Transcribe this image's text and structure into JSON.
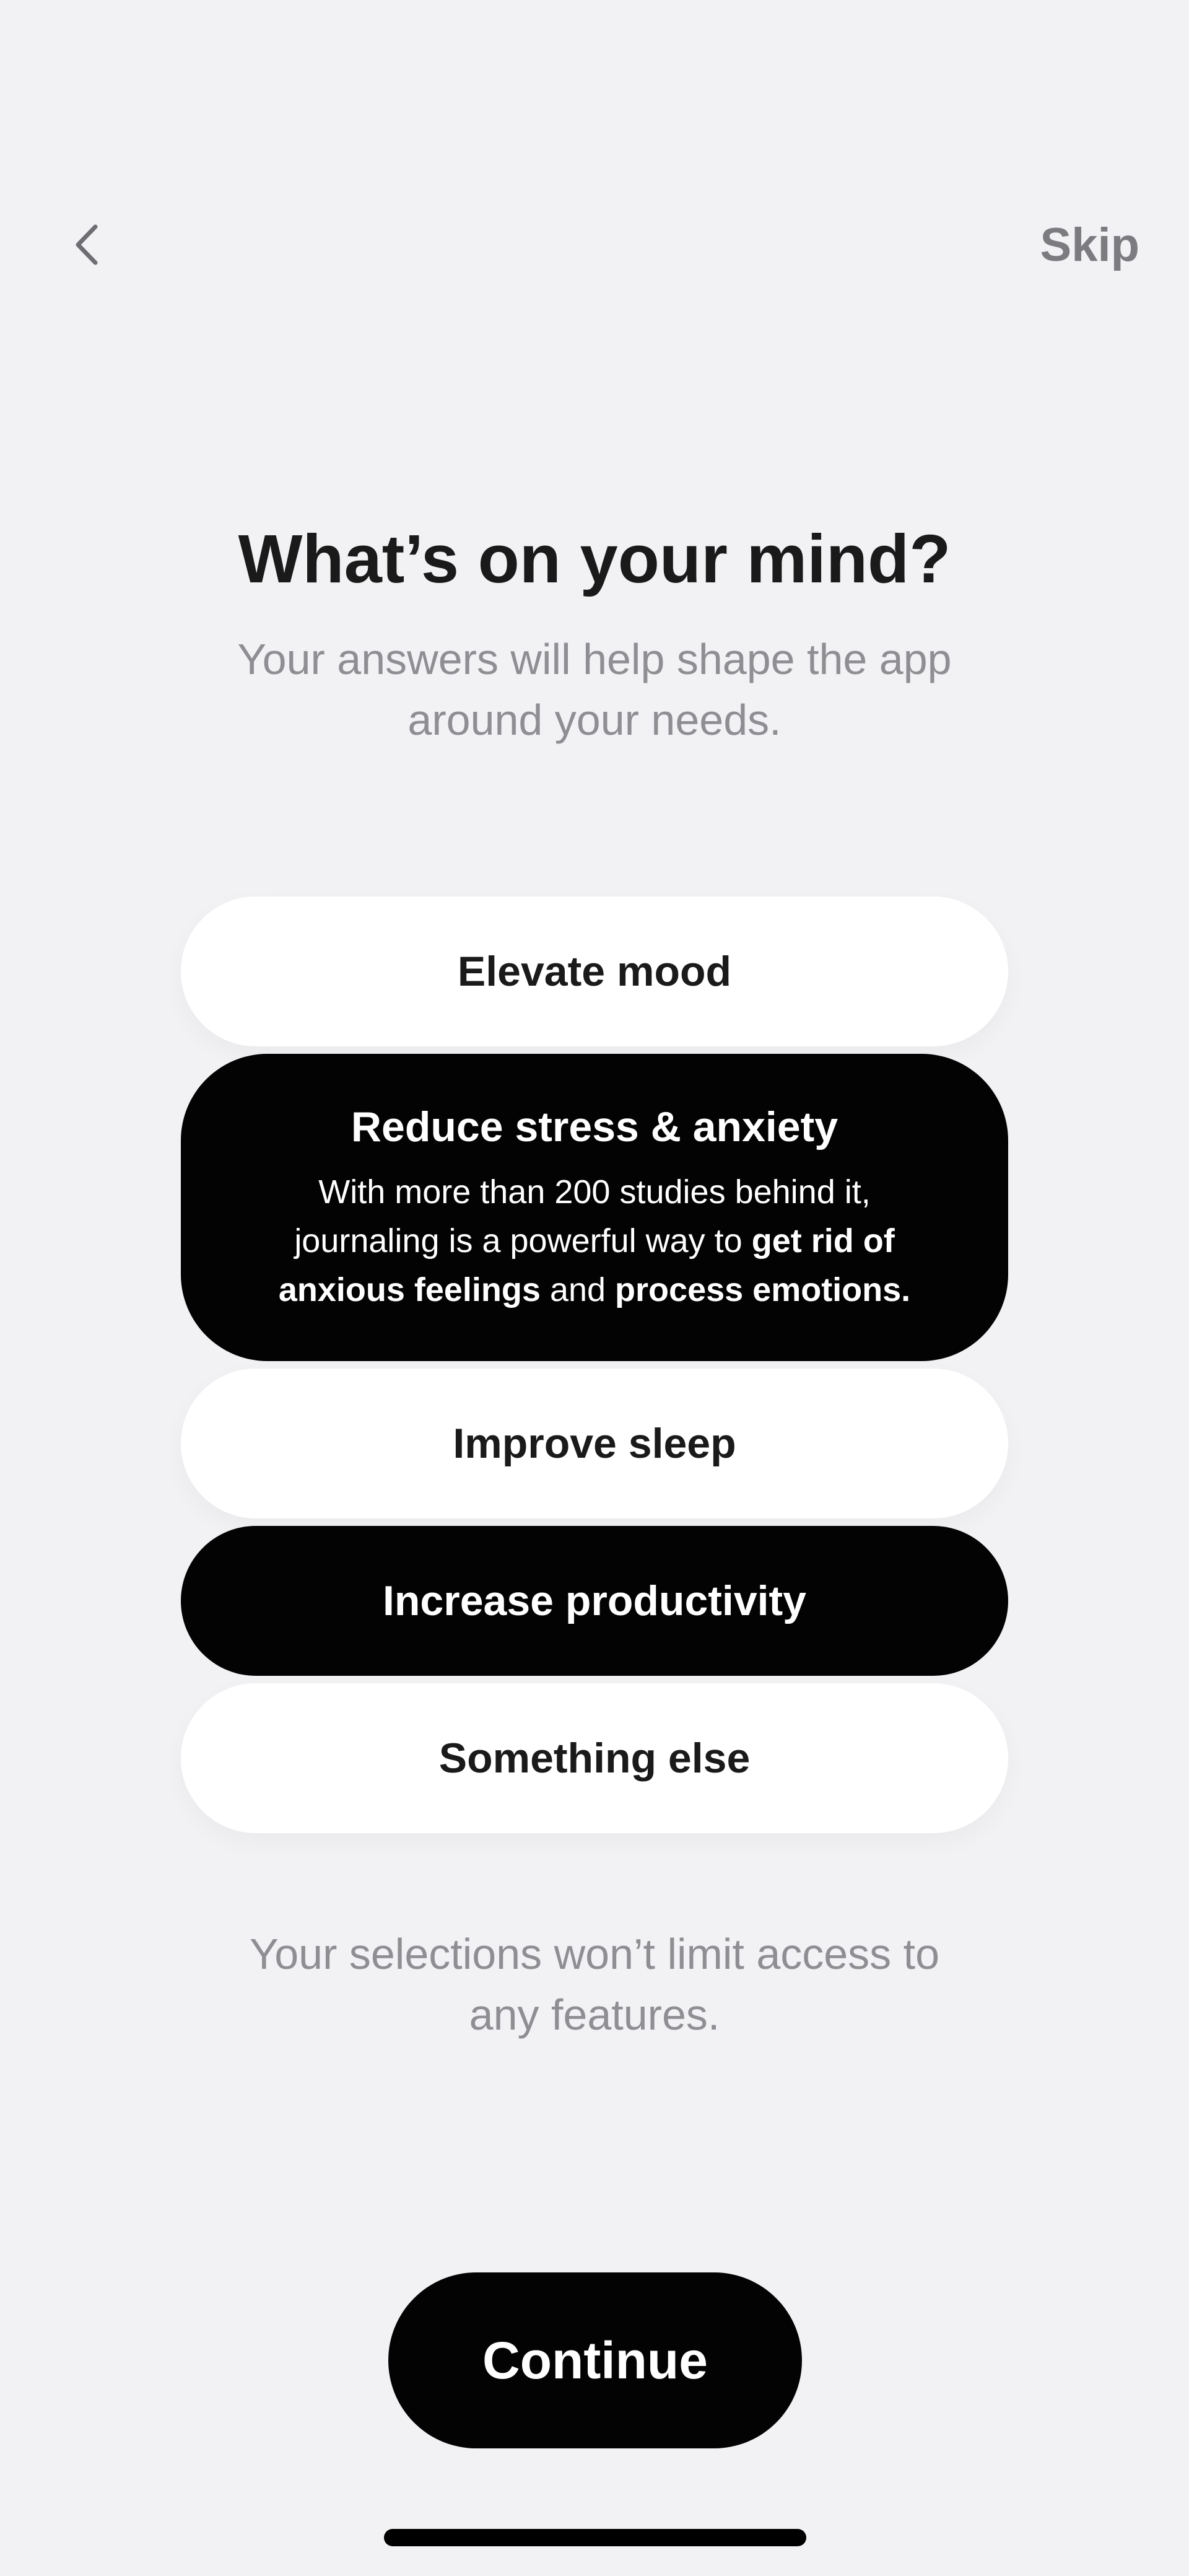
{
  "nav": {
    "back_icon": "chevron-left-icon",
    "skip_label": "Skip"
  },
  "header": {
    "title": "What’s on your mind?",
    "subtitle": "Your answers will help shape the app around your needs."
  },
  "options": [
    {
      "label": "Elevate mood",
      "selected": false
    },
    {
      "label": "Reduce stress & anxiety",
      "selected": true,
      "description": {
        "part1": "With more than 200 studies behind it, journaling is a powerful way to ",
        "bold1": "get rid of anxious feelings",
        "part2": " and ",
        "bold2": "process emotions."
      }
    },
    {
      "label": "Improve sleep",
      "selected": false
    },
    {
      "label": "Increase productivity",
      "selected": true
    },
    {
      "label": "Something else",
      "selected": false
    }
  ],
  "footnote": "Your selections won’t limit access to any features.",
  "continue_label": "Continue",
  "colors": {
    "background": "#f2f2f5",
    "selected_bg": "#030303",
    "unselected_bg": "#ffffff",
    "secondary_text": "#8e8e93",
    "skip_text": "#7c7c80"
  }
}
